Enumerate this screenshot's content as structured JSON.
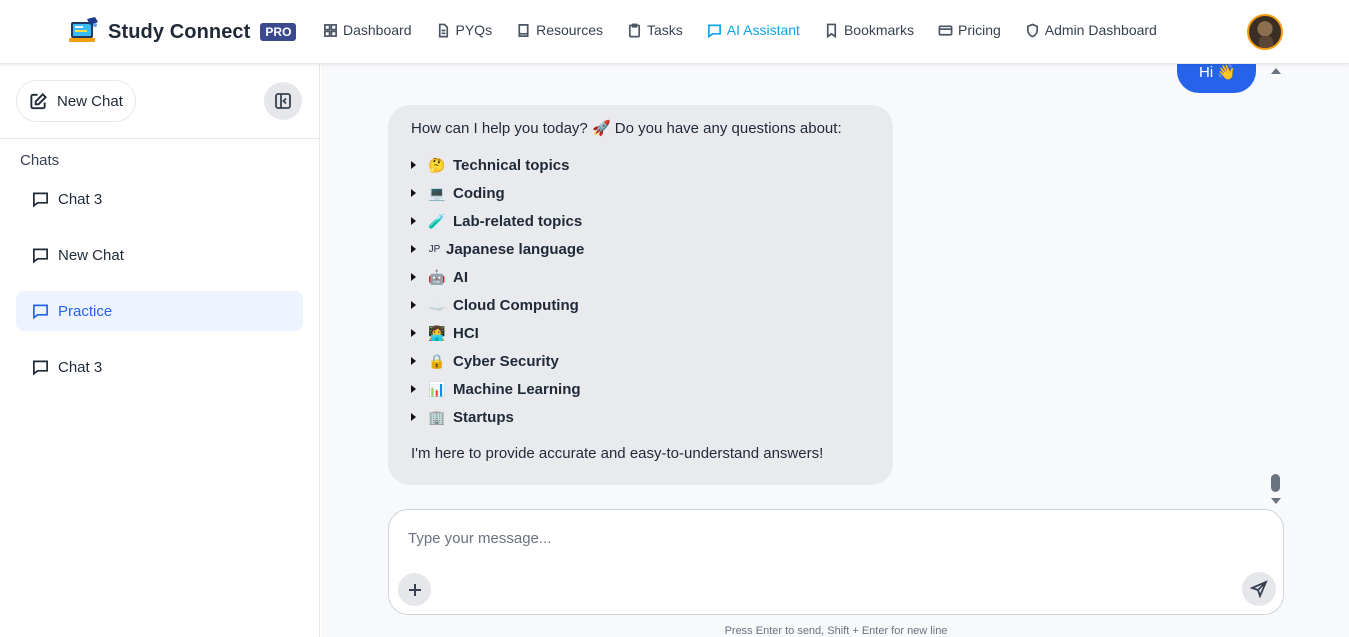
{
  "header": {
    "brand": "Study Connect",
    "badge": "PRO",
    "nav": [
      {
        "label": "Dashboard",
        "icon": "grid-icon"
      },
      {
        "label": "PYQs",
        "icon": "document-icon"
      },
      {
        "label": "Resources",
        "icon": "book-icon"
      },
      {
        "label": "Tasks",
        "icon": "clipboard-icon"
      },
      {
        "label": "AI Assistant",
        "icon": "chat-icon",
        "active": true
      },
      {
        "label": "Bookmarks",
        "icon": "bookmark-icon"
      },
      {
        "label": "Pricing",
        "icon": "card-icon"
      },
      {
        "label": "Admin Dashboard",
        "icon": "shield-icon"
      }
    ]
  },
  "sidebar": {
    "new_chat_label": "New Chat",
    "chats_heading": "Chats",
    "chats": [
      {
        "label": "Chat 3",
        "active": false
      },
      {
        "label": "New Chat",
        "active": false
      },
      {
        "label": "Practice",
        "active": true
      },
      {
        "label": "Chat 3",
        "active": false
      }
    ]
  },
  "conversation": {
    "user_message": "Hi 👋",
    "assistant_intro": "How can I help you today? 🚀 Do you have any questions about:",
    "topics": [
      {
        "emoji": "🤔",
        "label": "Technical topics"
      },
      {
        "emoji": "💻",
        "label": "Coding"
      },
      {
        "emoji": "🧪",
        "label": "Lab-related topics"
      },
      {
        "emoji": "JP",
        "label": "Japanese language"
      },
      {
        "emoji": "🤖",
        "label": "AI"
      },
      {
        "emoji": "☁️",
        "label": "Cloud Computing"
      },
      {
        "emoji": "👩‍💻",
        "label": "HCI"
      },
      {
        "emoji": "🔒",
        "label": "Cyber Security"
      },
      {
        "emoji": "📊",
        "label": "Machine Learning"
      },
      {
        "emoji": "🏢",
        "label": "Startups"
      }
    ],
    "assistant_outro": "I'm here to provide accurate and easy-to-understand answers!"
  },
  "composer": {
    "placeholder": "Type your message...",
    "value": "",
    "hint": "Press Enter to send, Shift + Enter for new line"
  },
  "colors": {
    "accent": "#2563eb",
    "nav_active": "#0ea5e9",
    "badge": "#3b4a8f"
  }
}
